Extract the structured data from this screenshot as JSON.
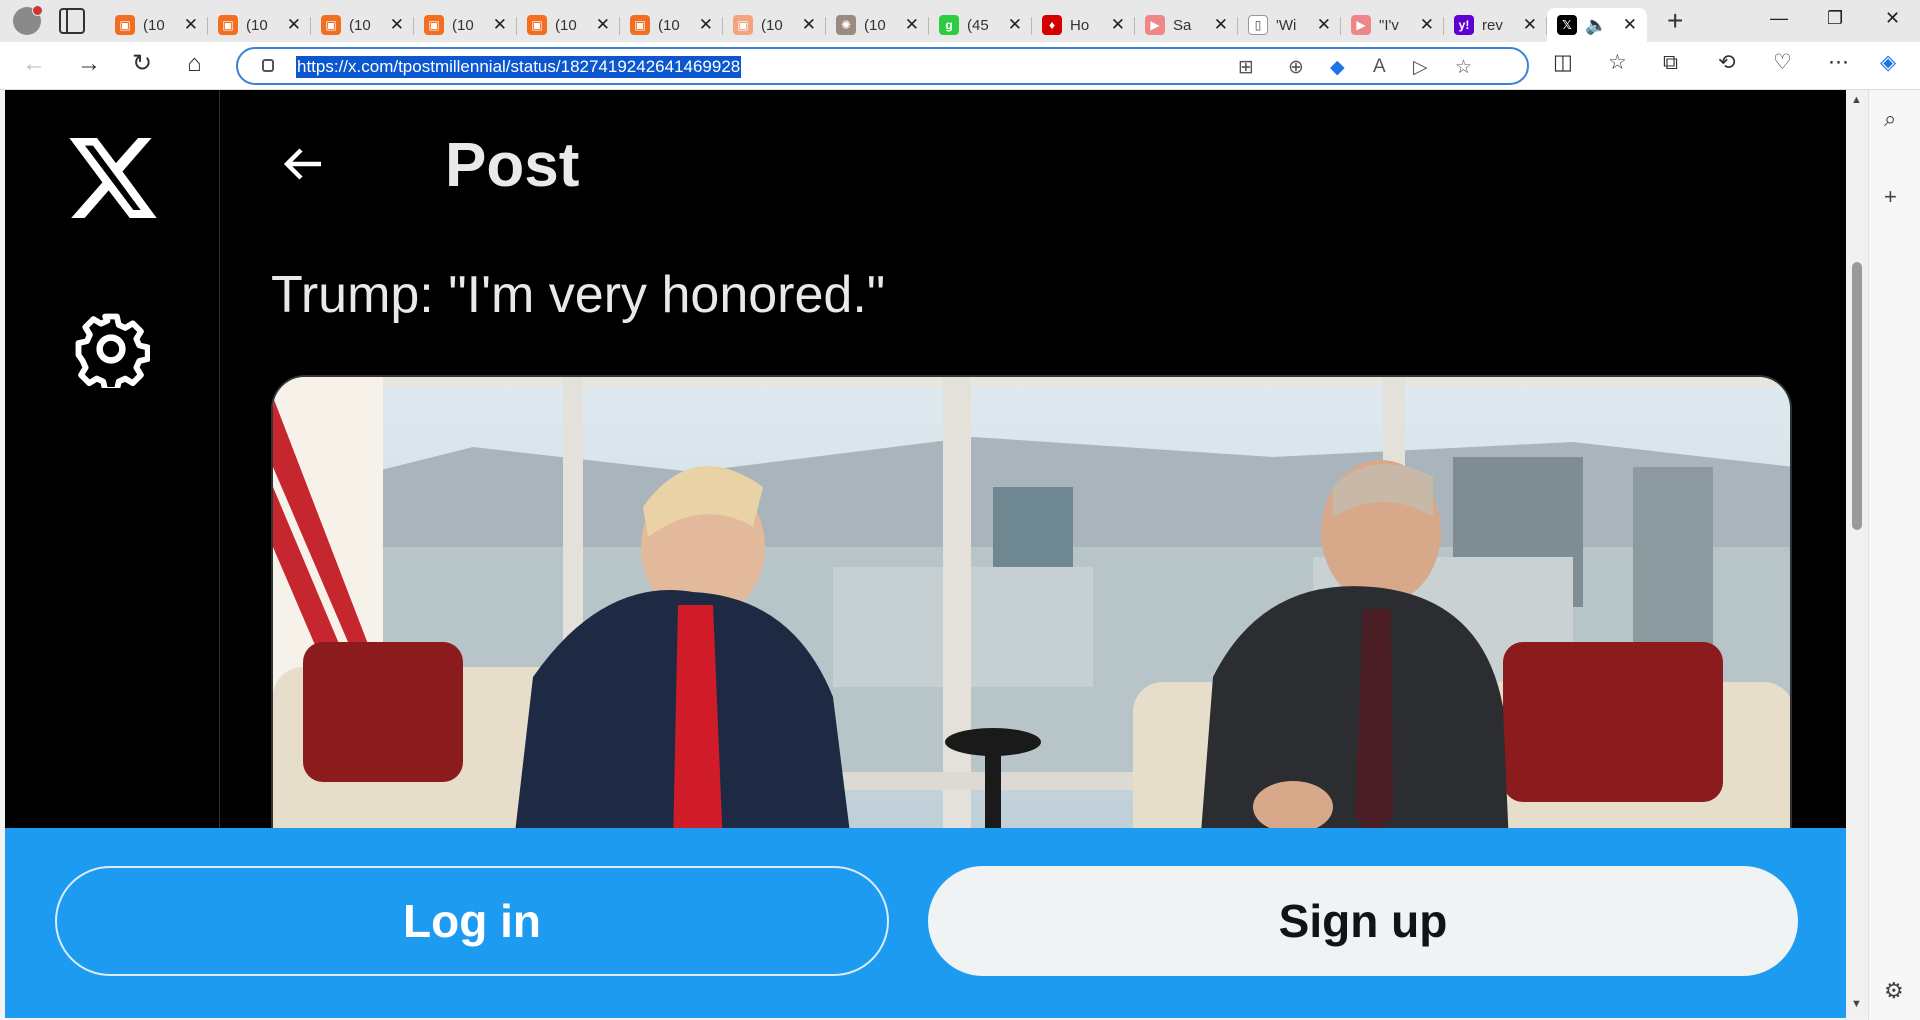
{
  "browser": {
    "tabs": [
      {
        "title": "(10",
        "color": "#f26f21",
        "glyph": "▣"
      },
      {
        "title": "(10",
        "color": "#f26f21",
        "glyph": "▣"
      },
      {
        "title": "(10",
        "color": "#f26f21",
        "glyph": "▣"
      },
      {
        "title": "(10",
        "color": "#f26f21",
        "glyph": "▣"
      },
      {
        "title": "(10",
        "color": "#f26f21",
        "glyph": "▣"
      },
      {
        "title": "(10",
        "color": "#f26f21",
        "glyph": "▣"
      },
      {
        "title": "(10",
        "color": "#f2a47e",
        "glyph": "▣"
      },
      {
        "title": "(10",
        "color": "#9a8a80",
        "glyph": "✺"
      },
      {
        "title": "(45",
        "color": "#2ecc40",
        "glyph": "g"
      },
      {
        "title": "Ho",
        "color": "#d40000",
        "glyph": "♦"
      },
      {
        "title": "Sa",
        "color": "#e88",
        "glyph": "▶"
      },
      {
        "title": "'Wi",
        "color": "#ffffff",
        "glyph": "▯"
      },
      {
        "title": "\"I'v",
        "color": "#e88",
        "glyph": "▶"
      },
      {
        "title": "rev",
        "color": "#6001d2",
        "glyph": "y!"
      }
    ],
    "active_tab": {
      "title": "",
      "favicon": "x-logo"
    },
    "url": "https://x.com/tpostmillennial/status/1827419242641469928"
  },
  "page": {
    "header_title": "Post",
    "tweet_text": "Trump: \"I'm very honored.\"",
    "login_label": "Log in",
    "signup_label": "Sign up"
  },
  "colors": {
    "x_background": "#000000",
    "x_blue": "#1d9bf0",
    "text_primary": "#e7e9ea"
  }
}
